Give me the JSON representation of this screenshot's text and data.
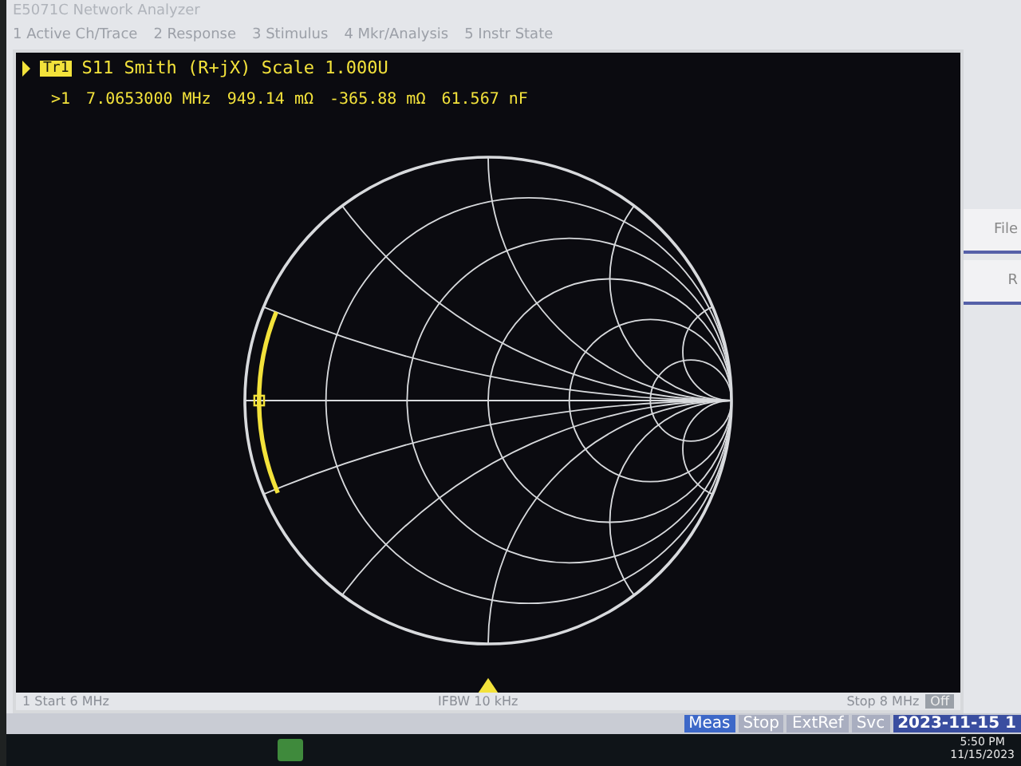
{
  "window": {
    "title": "E5071C Network Analyzer"
  },
  "menu": [
    {
      "label": "1 Active Ch/Trace"
    },
    {
      "label": "2 Response"
    },
    {
      "label": "3 Stimulus"
    },
    {
      "label": "4 Mkr/Analysis"
    },
    {
      "label": "5 Instr State"
    }
  ],
  "trace": {
    "badge": "Tr1",
    "title": "S11 Smith (R+jX) Scale 1.000U"
  },
  "marker": {
    "label": ">1",
    "frequency": "7.0653000 MHz",
    "resistance": "949.14 mΩ",
    "reactance": "-365.88 mΩ",
    "capacitance": "61.567 nF"
  },
  "footer": {
    "start": "1  Start 6 MHz",
    "ifbw": "IFBW 10 kHz",
    "stop": "Stop 8 MHz",
    "off": "Off"
  },
  "status": [
    {
      "label": "Meas",
      "selected": true
    },
    {
      "label": "Stop",
      "selected": false
    },
    {
      "label": "ExtRef",
      "selected": false
    },
    {
      "label": "Svc",
      "selected": false
    }
  ],
  "datetime": "2023-11-15 1",
  "softkeys": [
    {
      "label": "File"
    },
    {
      "label": "R"
    }
  ],
  "taskbar": {
    "time": "5:50 PM",
    "date": "11/15/2023"
  }
}
